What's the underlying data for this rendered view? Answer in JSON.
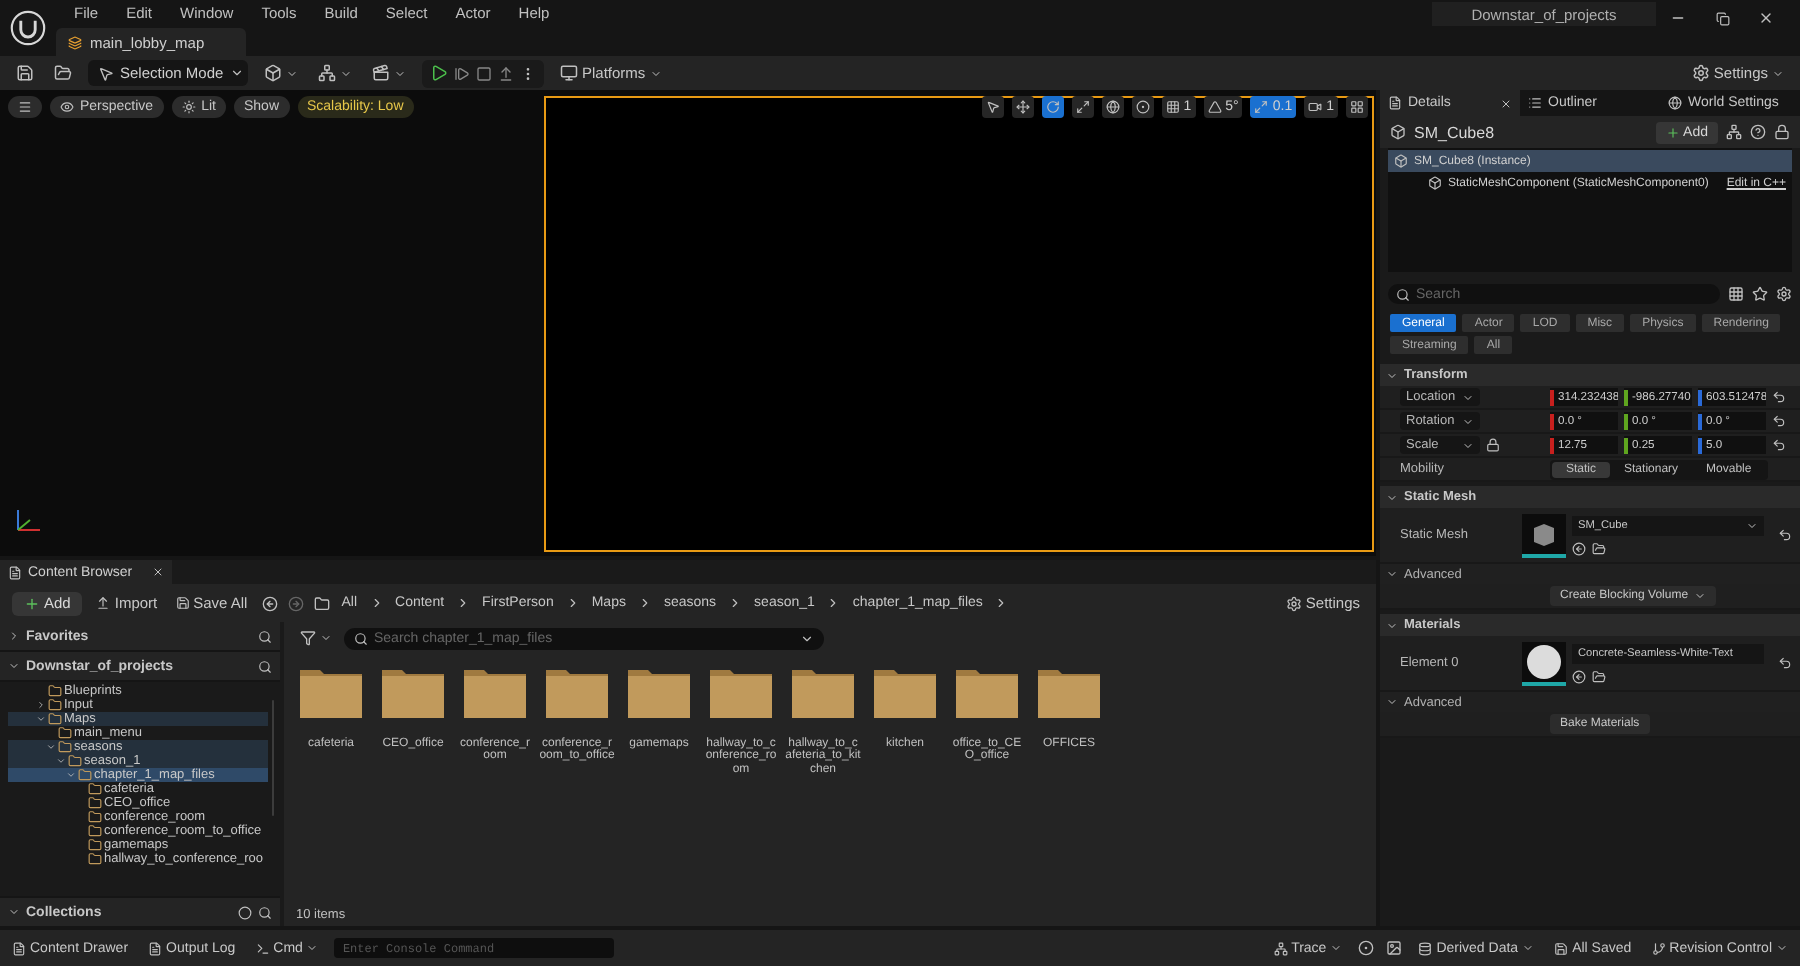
{
  "title_bar": {
    "menu": [
      "File",
      "Edit",
      "Window",
      "Tools",
      "Build",
      "Select",
      "Actor",
      "Help"
    ],
    "level_tab": "main_lobby_map",
    "project": "Downstar_of_projects"
  },
  "toolbar": {
    "mode": "Selection Mode",
    "platforms": "Platforms",
    "settings": "Settings"
  },
  "viewport": {
    "buttons": [
      {
        "label": "Perspective",
        "kind": "view"
      },
      {
        "label": "Lit",
        "kind": "view"
      },
      {
        "label": "Show",
        "kind": "plain"
      },
      {
        "label": "Scalability: Low",
        "kind": "warning"
      }
    ],
    "tools": [
      {
        "kind": "select",
        "selected": false
      },
      {
        "kind": "move",
        "selected": false
      },
      {
        "kind": "rotate",
        "selected": true
      },
      {
        "kind": "scale",
        "selected": false
      }
    ],
    "snaps": [
      {
        "kind": "grid",
        "value": "1",
        "selected": false
      },
      {
        "kind": "angle",
        "value": "5°",
        "selected": false
      },
      {
        "kind": "scale",
        "value": "0.1",
        "selected": true
      },
      {
        "kind": "camera",
        "value": "1",
        "selected": false
      }
    ]
  },
  "details": {
    "tabs": [
      {
        "label": "Details",
        "selected": true
      },
      {
        "label": "Outliner",
        "selected": false
      },
      {
        "label": "World Settings",
        "selected": false
      }
    ],
    "actor": "SM_Cube8",
    "add": "Add",
    "components": [
      {
        "label": "SM_Cube8 (Instance)",
        "selected": true
      },
      {
        "label": "StaticMeshComponent (StaticMeshComponent0)",
        "selected": false,
        "link": "Edit in C++"
      }
    ],
    "search": {
      "placeholder": "Search"
    },
    "filters": [
      {
        "label": "General",
        "selected": true
      },
      {
        "label": "Actor",
        "selected": false
      },
      {
        "label": "LOD",
        "selected": false
      },
      {
        "label": "Misc",
        "selected": false
      },
      {
        "label": "Physics",
        "selected": false
      },
      {
        "label": "Rendering",
        "selected": false
      },
      {
        "label": "Streaming",
        "selected": false
      },
      {
        "label": "All",
        "selected": false
      }
    ],
    "sections": [
      {
        "title": "Transform",
        "expanded": true,
        "rows": [
          {
            "kind": "vector",
            "label": "Location",
            "lockable": false,
            "values": [
              {
                "text": "314.232438",
                "color": "#c8201e"
              },
              {
                "text": "-986.27740",
                "color": "#5fa51f"
              },
              {
                "text": "603.512478",
                "color": "#2a6ad8"
              }
            ]
          },
          {
            "kind": "vector",
            "label": "Rotation",
            "lockable": false,
            "values": [
              {
                "text": "0.0 °",
                "color": "#c8201e"
              },
              {
                "text": "0.0 °",
                "color": "#5fa51f"
              },
              {
                "text": "0.0 °",
                "color": "#2a6ad8"
              }
            ]
          },
          {
            "kind": "vector",
            "label": "Scale",
            "lockable": true,
            "values": [
              {
                "text": "12.75",
                "color": "#c8201e"
              },
              {
                "text": "0.25",
                "color": "#5fa51f"
              },
              {
                "text": "5.0",
                "color": "#2a6ad8"
              }
            ]
          },
          {
            "kind": "segmented",
            "label": "Mobility",
            "options": [
              {
                "label": "Static",
                "selected": true
              },
              {
                "label": "Stationary",
                "selected": false
              },
              {
                "label": "Movable",
                "selected": false
              }
            ]
          }
        ]
      },
      {
        "title": "Static Mesh",
        "expanded": true,
        "rows": [
          {
            "kind": "mesh_asset",
            "label": "Static Mesh",
            "asset": "SM_Cube"
          },
          {
            "kind": "subheader",
            "label": "Advanced",
            "expanded": true
          },
          {
            "kind": "button",
            "label": "Create Blocking Volume"
          }
        ]
      },
      {
        "title": "Materials",
        "expanded": true,
        "rows": [
          {
            "kind": "material_asset",
            "label": "Element 0",
            "asset": "Concrete-Seamless-White-Text"
          },
          {
            "kind": "subheader",
            "label": "Advanced",
            "expanded": true
          },
          {
            "kind": "button",
            "label": "Bake Materials"
          }
        ]
      }
    ]
  },
  "content_browser": {
    "tab": "Content Browser",
    "add": "Add",
    "import": "Import",
    "save_all": "Save All",
    "breadcrumb": [
      "All",
      "Content",
      "FirstPerson",
      "Maps",
      "seasons",
      "season_1",
      "chapter_1_map_files"
    ],
    "settings": "Settings",
    "favorites": {
      "label": "Favorites",
      "expanded": false
    },
    "project": {
      "label": "Downstar_of_projects",
      "expanded": true
    },
    "tree": [
      {
        "label": "Blueprints",
        "selected": false
      },
      {
        "label": "Input",
        "selected": false,
        "expanded": false
      },
      {
        "label": "Maps",
        "selected": false,
        "expanded": true,
        "children": [
          {
            "label": "main_menu",
            "selected": false
          },
          {
            "label": "seasons",
            "selected": false,
            "expanded": true,
            "children": [
              {
                "label": "season_1",
                "selected": false,
                "expanded": true,
                "children": [
                  {
                    "label": "chapter_1_map_files",
                    "selected": true,
                    "expanded": true,
                    "children": [
                      {
                        "label": "cafeteria",
                        "selected": false
                      },
                      {
                        "label": "CEO_office",
                        "selected": false
                      },
                      {
                        "label": "conference_room",
                        "selected": false
                      },
                      {
                        "label": "conference_room_to_office",
                        "selected": false
                      },
                      {
                        "label": "gamemaps",
                        "selected": false
                      },
                      {
                        "label": "hallway_to_conference_roo",
                        "selected": false
                      }
                    ]
                  }
                ]
              }
            ]
          }
        ]
      }
    ],
    "collections": {
      "label": "Collections",
      "expanded": true
    },
    "search": {
      "placeholder": "Search chapter_1_map_files"
    },
    "folders": [
      "cafeteria",
      "CEO_office",
      "conference_room",
      "conference_room_to_office",
      "gamemaps",
      "hallway_to_conference_room",
      "hallway_to_cafeteria_to_kitchen",
      "kitchen",
      "office_to_CEO_office",
      "OFFICES"
    ],
    "count": "10 items"
  },
  "status_bar": {
    "content_drawer": "Content Drawer",
    "output_log": "Output Log",
    "cmd": "Cmd",
    "console": {
      "placeholder": "Enter Console Command"
    },
    "trace": "Trace",
    "derived_data": "Derived Data",
    "saved": "All Saved",
    "revision": "Revision Control"
  }
}
